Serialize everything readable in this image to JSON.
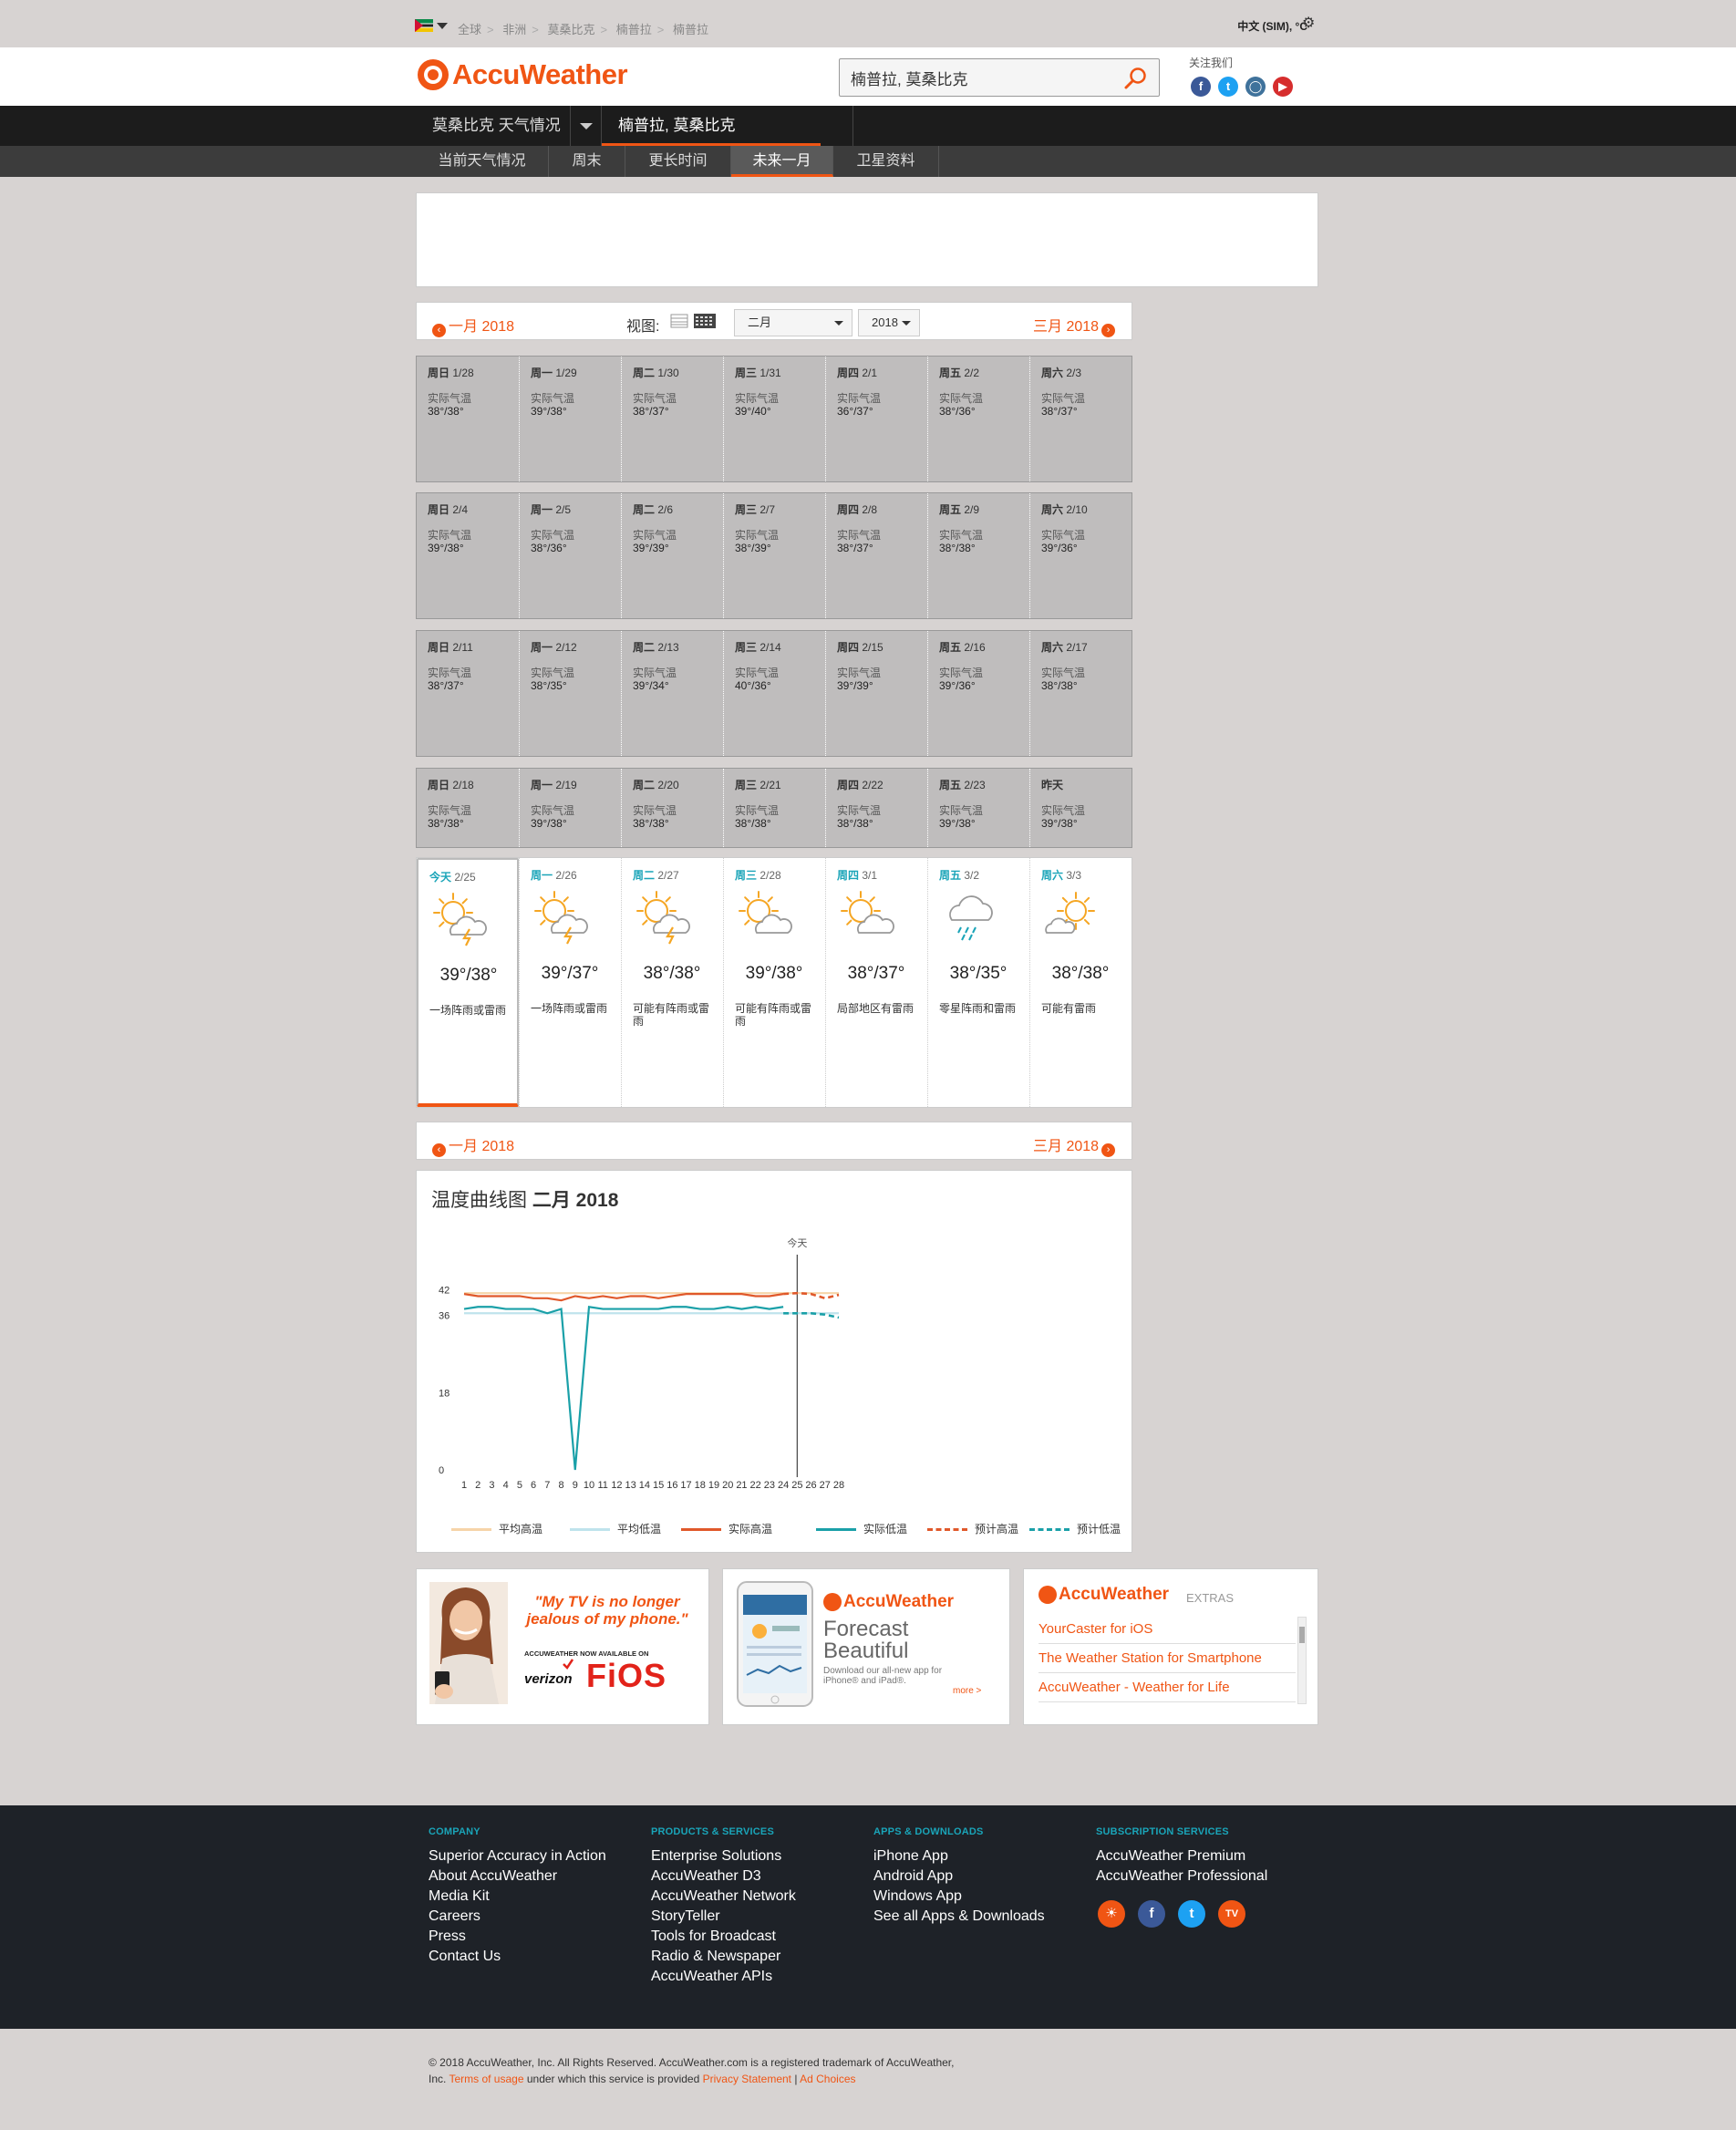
{
  "breadcrumb": [
    "全球",
    "非洲",
    "莫桑比克",
    "楠普拉",
    "楠普拉"
  ],
  "settings": {
    "language_units": "中文 (SIM), °C"
  },
  "brand": {
    "name": "AccuWeather"
  },
  "search": {
    "value": "楠普拉, 莫桑比克"
  },
  "follow": {
    "label": "关注我们"
  },
  "nav": {
    "country": "莫桑比克 天气情况",
    "city": "楠普拉, 莫桑比克",
    "tabs": [
      "当前天气情况",
      "周末",
      "更长时间",
      "未来一月",
      "卫星资料"
    ],
    "active_tab": "未来一月"
  },
  "month_bar": {
    "prev": "一月 2018",
    "next": "三月 2018",
    "view_label": "视图:",
    "month_select": "二月",
    "year_select": "2018"
  },
  "calendar": {
    "actual_label": "实际气温",
    "weeks": [
      [
        {
          "dow": "周日",
          "date": "1/28",
          "temp": "38°/38°"
        },
        {
          "dow": "周一",
          "date": "1/29",
          "temp": "39°/38°"
        },
        {
          "dow": "周二",
          "date": "1/30",
          "temp": "38°/37°"
        },
        {
          "dow": "周三",
          "date": "1/31",
          "temp": "39°/40°"
        },
        {
          "dow": "周四",
          "date": "2/1",
          "temp": "36°/37°"
        },
        {
          "dow": "周五",
          "date": "2/2",
          "temp": "38°/36°"
        },
        {
          "dow": "周六",
          "date": "2/3",
          "temp": "38°/37°"
        }
      ],
      [
        {
          "dow": "周日",
          "date": "2/4",
          "temp": "39°/38°"
        },
        {
          "dow": "周一",
          "date": "2/5",
          "temp": "38°/36°"
        },
        {
          "dow": "周二",
          "date": "2/6",
          "temp": "39°/39°"
        },
        {
          "dow": "周三",
          "date": "2/7",
          "temp": "38°/39°"
        },
        {
          "dow": "周四",
          "date": "2/8",
          "temp": "38°/37°"
        },
        {
          "dow": "周五",
          "date": "2/9",
          "temp": "38°/38°"
        },
        {
          "dow": "周六",
          "date": "2/10",
          "temp": "39°/36°"
        }
      ],
      [
        {
          "dow": "周日",
          "date": "2/11",
          "temp": "38°/37°"
        },
        {
          "dow": "周一",
          "date": "2/12",
          "temp": "38°/35°"
        },
        {
          "dow": "周二",
          "date": "2/13",
          "temp": "39°/34°"
        },
        {
          "dow": "周三",
          "date": "2/14",
          "temp": "40°/36°"
        },
        {
          "dow": "周四",
          "date": "2/15",
          "temp": "39°/39°"
        },
        {
          "dow": "周五",
          "date": "2/16",
          "temp": "39°/36°"
        },
        {
          "dow": "周六",
          "date": "2/17",
          "temp": "38°/38°"
        }
      ],
      [
        {
          "dow": "周日",
          "date": "2/18",
          "temp": "38°/38°"
        },
        {
          "dow": "周一",
          "date": "2/19",
          "temp": "39°/38°"
        },
        {
          "dow": "周二",
          "date": "2/20",
          "temp": "38°/38°"
        },
        {
          "dow": "周三",
          "date": "2/21",
          "temp": "38°/38°"
        },
        {
          "dow": "周四",
          "date": "2/22",
          "temp": "38°/38°"
        },
        {
          "dow": "周五",
          "date": "2/23",
          "temp": "39°/38°"
        },
        {
          "dow": "昨天",
          "date": "",
          "temp": "39°/38°"
        }
      ]
    ],
    "forecast": [
      {
        "dow": "今天",
        "date": "2/25",
        "temp": "39°/38°",
        "desc": "一场阵雨或雷雨",
        "icon": "sun-cloud-thunder-icon"
      },
      {
        "dow": "周一",
        "date": "2/26",
        "temp": "39°/37°",
        "desc": "一场阵雨或雷雨",
        "icon": "sun-cloud-thunder-icon"
      },
      {
        "dow": "周二",
        "date": "2/27",
        "temp": "38°/38°",
        "desc": "可能有阵雨或雷雨",
        "icon": "sun-cloud-thunder-icon"
      },
      {
        "dow": "周三",
        "date": "2/28",
        "temp": "39°/38°",
        "desc": "可能有阵雨或雷雨",
        "icon": "sun-cloud-icon"
      },
      {
        "dow": "周四",
        "date": "3/1",
        "temp": "38°/37°",
        "desc": "局部地区有雷雨",
        "icon": "sun-cloud-icon"
      },
      {
        "dow": "周五",
        "date": "3/2",
        "temp": "38°/35°",
        "desc": "零星阵雨和雷雨",
        "icon": "cloud-rain-icon"
      },
      {
        "dow": "周六",
        "date": "3/3",
        "temp": "38°/38°",
        "desc": "可能有雷雨",
        "icon": "sun-small-cloud-icon"
      }
    ]
  },
  "chart_data": {
    "type": "line",
    "title": "温度曲线图",
    "subtitle": "二月 2018",
    "today_label": "今天",
    "y_ticks": [
      0,
      18,
      36,
      42
    ],
    "x": [
      1,
      2,
      3,
      4,
      5,
      6,
      7,
      8,
      9,
      10,
      11,
      12,
      13,
      14,
      15,
      16,
      17,
      18,
      19,
      20,
      21,
      22,
      23,
      24,
      25,
      26,
      27,
      28
    ],
    "series": [
      {
        "name": "平均高温",
        "style": "solid",
        "color": "#f6d4a8",
        "x": [
          1,
          28
        ],
        "values": [
          41.2,
          41.2
        ]
      },
      {
        "name": "平均低温",
        "style": "solid",
        "color": "#bfe3ec",
        "x": [
          1,
          28
        ],
        "values": [
          36.5,
          36.5
        ]
      },
      {
        "name": "实际高温",
        "style": "solid",
        "color": "#e0582a",
        "x": [
          1,
          2,
          3,
          4,
          5,
          6,
          7,
          8,
          9,
          10,
          11,
          12,
          13,
          14,
          15,
          16,
          17,
          18,
          19,
          20,
          21,
          22,
          23,
          24
        ],
        "values": [
          41,
          40.5,
          40.5,
          40.5,
          40.5,
          40,
          40,
          39.5,
          40.5,
          40,
          40.5,
          40,
          40.5,
          40.5,
          40,
          40.5,
          41,
          41,
          41,
          41,
          41,
          40.5,
          40.5,
          41
        ]
      },
      {
        "name": "实际低温",
        "style": "solid",
        "color": "#1aa0a8",
        "x": [
          1,
          2,
          3,
          4,
          5,
          6,
          7,
          8,
          9,
          10,
          11,
          12,
          13,
          14,
          15,
          16,
          17,
          18,
          19,
          20,
          21,
          22,
          23,
          24
        ],
        "values": [
          37.5,
          38,
          38,
          37.5,
          37.5,
          37.5,
          36.5,
          37.5,
          0,
          38,
          37.5,
          37.5,
          37.5,
          37.5,
          37.5,
          38,
          38,
          37.5,
          37.5,
          38,
          37.5,
          38,
          37.5,
          38
        ]
      },
      {
        "name": "预计高温",
        "style": "dashed",
        "color": "#e0582a",
        "x": [
          24,
          25,
          26,
          27,
          28
        ],
        "values": [
          41,
          41.2,
          41,
          40,
          40.8
        ]
      },
      {
        "name": "预计低温",
        "style": "dashed",
        "color": "#1aa0a8",
        "x": [
          24,
          25,
          26,
          27,
          28
        ],
        "values": [
          36.5,
          36.5,
          36.5,
          36.2,
          35.5
        ]
      }
    ]
  },
  "promos": {
    "fios": {
      "quote": "\"My TV is no longer jealous of my phone.\"",
      "small": "ACCUWEATHER NOW AVAILABLE ON",
      "verizon": "verizon",
      "fios": "FiOS"
    },
    "app": {
      "brand": "AccuWeather",
      "headline1": "Forecast",
      "headline2": "Beautiful",
      "body": "Download our all-new app for iPhone® and iPad®.",
      "more": "more >"
    },
    "extras": {
      "brand": "AccuWeather",
      "suffix": "EXTRAS",
      "links": [
        "YourCaster for iOS",
        "The Weather Station for Smartphone",
        "AccuWeather - Weather for Life"
      ]
    }
  },
  "footer": {
    "columns": [
      {
        "title": "COMPANY",
        "items": [
          "Superior Accuracy in Action",
          "About AccuWeather",
          "Media Kit",
          "Careers",
          "Press",
          "Contact Us"
        ]
      },
      {
        "title": "PRODUCTS & SERVICES",
        "items": [
          "Enterprise Solutions",
          "AccuWeather D3",
          "AccuWeather Network",
          "StoryTeller",
          "Tools for Broadcast",
          "Radio & Newspaper",
          "AccuWeather APIs"
        ]
      },
      {
        "title": "APPS & DOWNLOADS",
        "items": [
          "iPhone App",
          "Android App",
          "Windows App",
          "See all Apps & Downloads"
        ]
      },
      {
        "title": "SUBSCRIPTION SERVICES",
        "items": [
          "AccuWeather Premium",
          "AccuWeather Professional"
        ]
      }
    ],
    "copyright_1": "© 2018 AccuWeather, Inc. All Rights Reserved. AccuWeather.com is a registered trademark of AccuWeather, Inc.",
    "terms": "Terms of usage",
    "copyright_2": "under which this service is provided",
    "privacy": "Privacy Statement",
    "adchoices": "Ad Choices"
  },
  "colors": {
    "brand_orange": "#f05514",
    "teal": "#1aa4b8",
    "footer_bg": "#1e2228"
  }
}
